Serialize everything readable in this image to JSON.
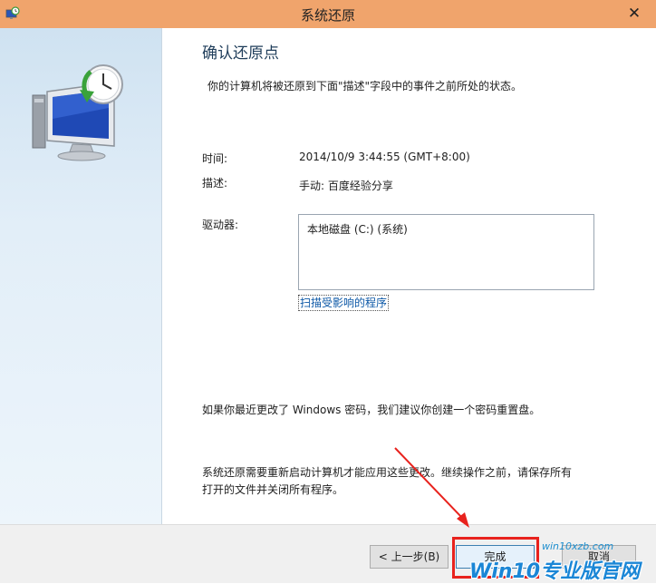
{
  "window": {
    "title": "系统还原",
    "close_glyph": "✕"
  },
  "main": {
    "heading": "确认还原点",
    "intro": "你的计算机将被还原到下面\"描述\"字段中的事件之前所处的状态。",
    "time_label": "时间:",
    "time_value": "2014/10/9 3:44:55 (GMT+8:00)",
    "desc_label": "描述:",
    "desc_value": "手动: 百度经验分享",
    "drive_label": "驱动器:",
    "drives": [
      "本地磁盘 (C:) (系统)"
    ],
    "scan_link": "扫描受影响的程序",
    "password_note": "如果你最近更改了 Windows 密码，我们建议你创建一个密码重置盘。",
    "restart_note_line1": "系统还原需要重新启动计算机才能应用这些更改。继续操作之前，请保存所有",
    "restart_note_line2": "打开的文件并关闭所有程序。"
  },
  "buttons": {
    "back": "< 上一步(B)",
    "finish": "完成",
    "cancel": "取消"
  },
  "watermark": {
    "url": "win10xzb.com",
    "brand": "Win10专业版官网"
  },
  "colors": {
    "titlebar": "#f0a46c",
    "highlight": "#e8221d",
    "link": "#0b57a6"
  }
}
